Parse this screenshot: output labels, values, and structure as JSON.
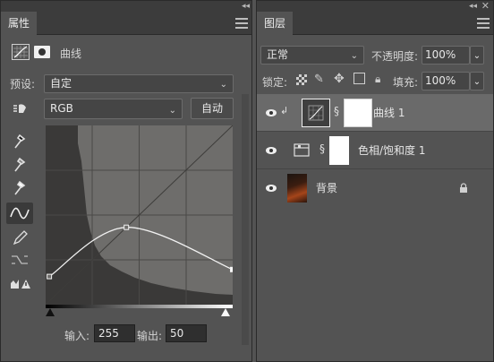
{
  "properties": {
    "tab_label": "属性",
    "adjustment_title": "曲线",
    "preset_label": "预设:",
    "preset_value": "自定",
    "channel_value": "RGB",
    "auto_label": "自动",
    "input_label": "输入:",
    "input_value": "255",
    "output_label": "输出:",
    "output_value": "50",
    "curve_points": [
      {
        "input": 5,
        "output": 40
      },
      {
        "input": 110,
        "output": 110
      },
      {
        "input": 255,
        "output": 50
      }
    ]
  },
  "layers_panel": {
    "tab_label": "图层",
    "blend_mode": "正常",
    "opacity_label": "不透明度:",
    "opacity_value": "100%",
    "lock_label": "锁定:",
    "fill_label": "填充:",
    "fill_value": "100%",
    "layers": [
      {
        "name": "曲线 1",
        "type": "curves-adjustment",
        "selected": true
      },
      {
        "name": "色相/饱和度 1",
        "type": "hue-saturation-adjustment",
        "selected": false
      },
      {
        "name": "背景",
        "type": "background-image",
        "locked": true
      }
    ]
  },
  "colors": {
    "panel_bg": "#535353",
    "tab_bar_bg": "#3c3c3c",
    "selected_layer_bg": "#6a6a6a",
    "curve_graph_bg": "#6e6d6b",
    "histogram_fill": "#3a3938"
  }
}
